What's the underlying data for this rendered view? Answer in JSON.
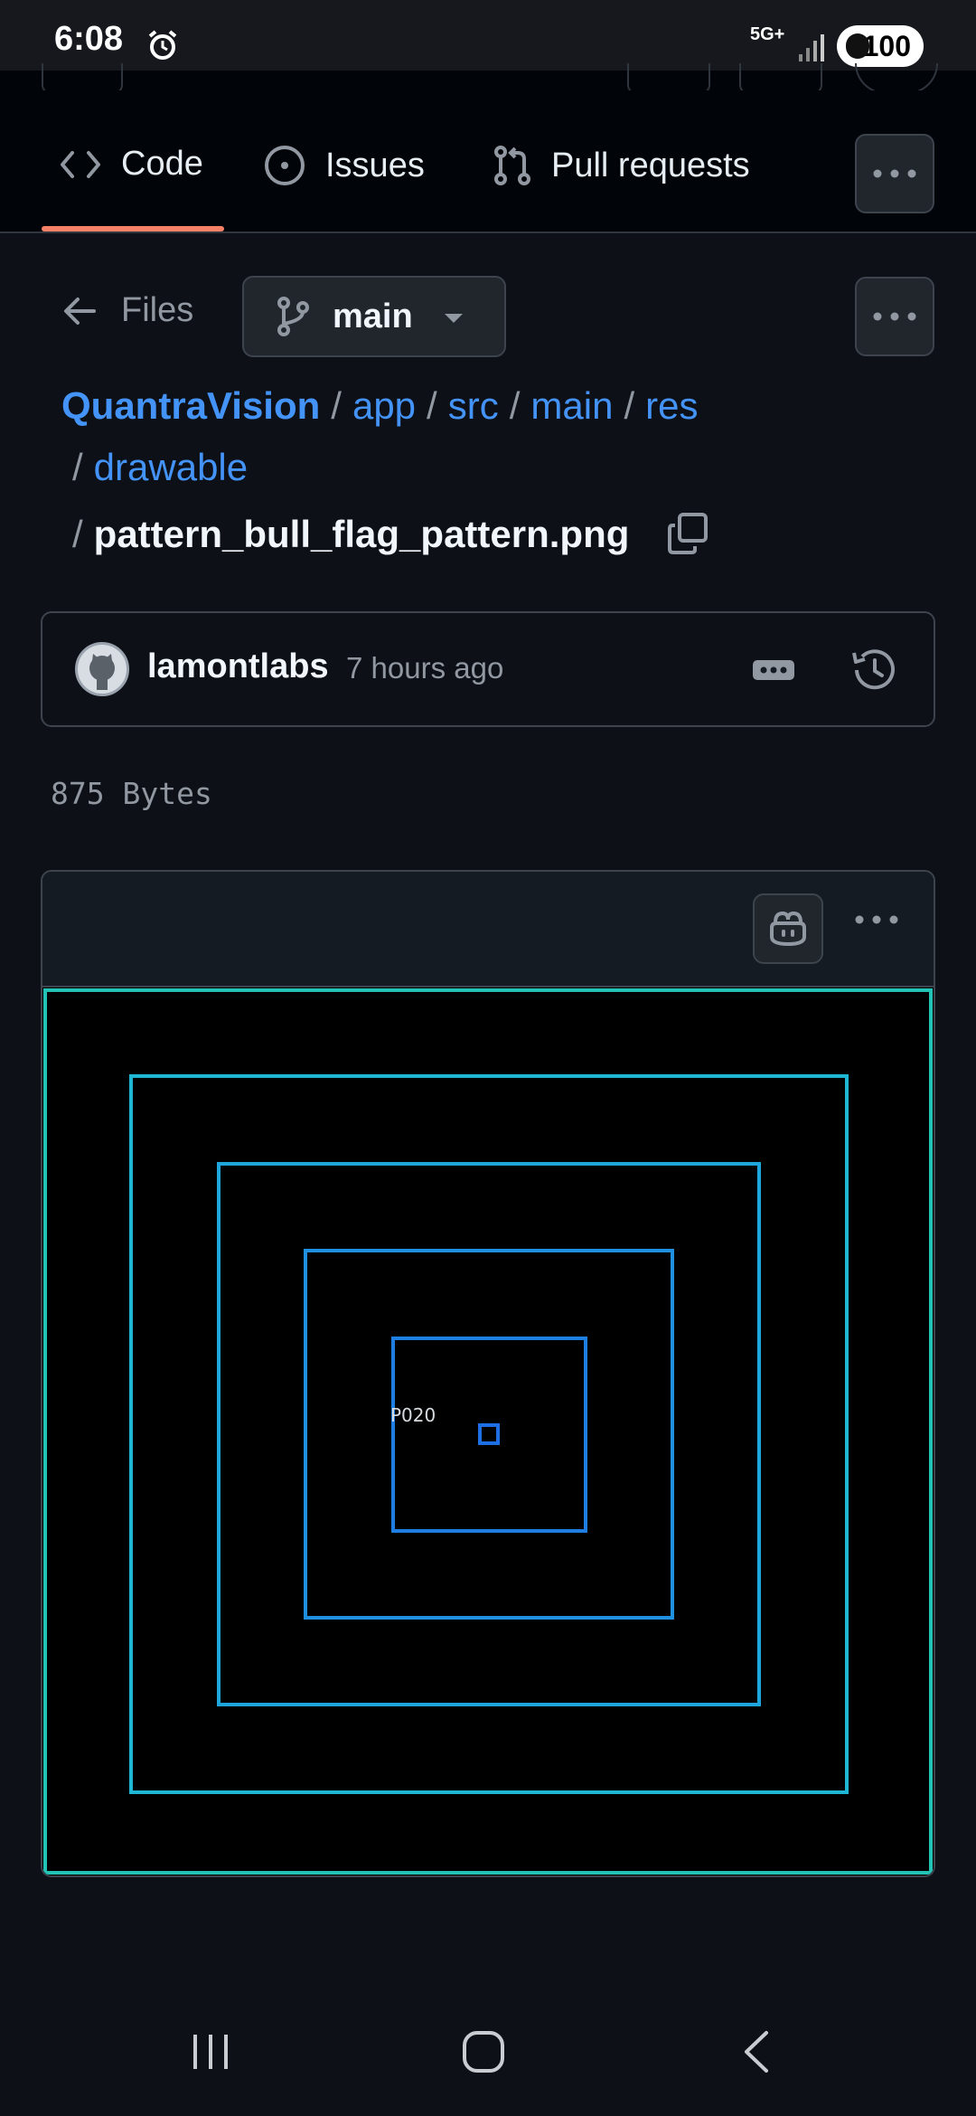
{
  "status_bar": {
    "time": "6:08",
    "network": "5G+",
    "battery": "100"
  },
  "repo_nav": {
    "tabs": [
      {
        "label": "Code",
        "icon": "code-icon",
        "selected": true
      },
      {
        "label": "Issues",
        "icon": "issue-opened-icon",
        "selected": false
      },
      {
        "label": "Pull requests",
        "icon": "git-pull-request-icon",
        "selected": false
      }
    ],
    "accent_color": "#f78166"
  },
  "file_nav": {
    "back_label": "Files",
    "branch": "main"
  },
  "breadcrumb": {
    "repo": "QuantraVision",
    "segments": [
      "app",
      "src",
      "main",
      "res",
      "drawable"
    ],
    "separator": "/",
    "file": "pattern_bull_flag_pattern.png"
  },
  "commit": {
    "author": "lamontlabs",
    "time": "7 hours ago"
  },
  "file_info": {
    "size": "875 Bytes"
  },
  "image_preview": {
    "label": "P020",
    "frame_colors": [
      "#22c3b5",
      "#1fb6d3",
      "#1ea6dc",
      "#1f8fe0",
      "#1f7ee2",
      "#1e6fe4"
    ]
  }
}
